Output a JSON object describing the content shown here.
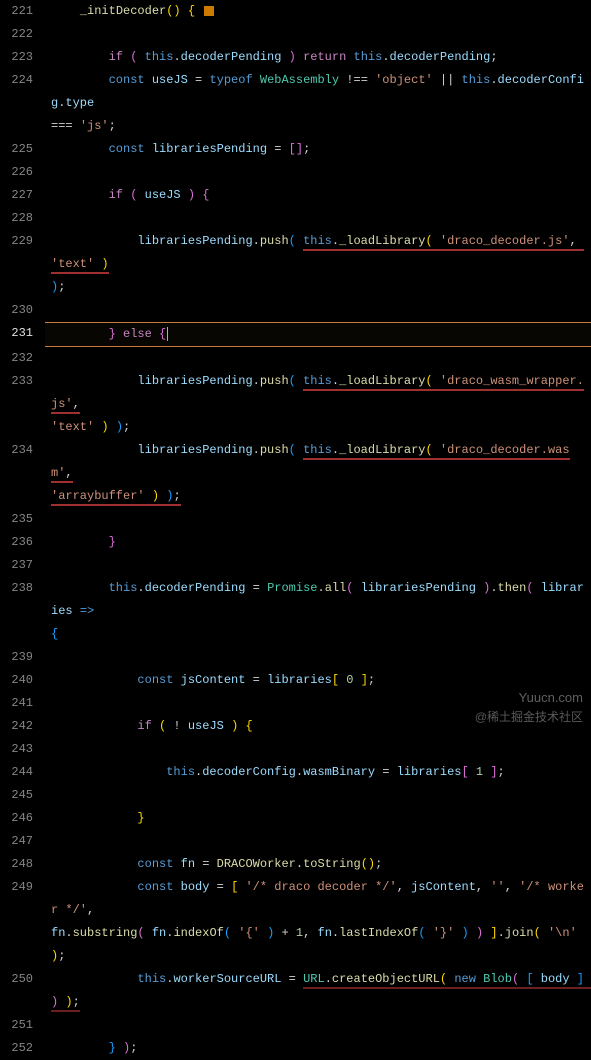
{
  "lineNumbers": [
    "221",
    "222",
    "223",
    "224",
    "",
    "225",
    "226",
    "227",
    "228",
    "229",
    "",
    "230",
    "231",
    "232",
    "233",
    "",
    "234",
    "",
    "235",
    "236",
    "237",
    "238",
    "",
    "239",
    "240",
    "241",
    "242",
    "243",
    "244",
    "245",
    "246",
    "247",
    "248",
    "249",
    "",
    "250",
    "251",
    "252"
  ],
  "code": {
    "l221_fn": "_initDecoder",
    "kw_if": "if",
    "kw_return": "return",
    "kw_this": "this",
    "kw_const": "const",
    "kw_typeof": "typeof",
    "kw_else": "else",
    "kw_new": "new",
    "prop_decoderPending": "decoderPending",
    "var_useJS": "useJS",
    "cls_WebAssembly": "WebAssembly",
    "str_object": "'object'",
    "prop_decoderConfig": "decoderConfig",
    "prop_type": "type",
    "str_js": "'js'",
    "var_librariesPending": "librariesPending",
    "fn_push": "push",
    "fn_loadLibrary": "_loadLibrary",
    "str_draco_decoder_js": "'draco_decoder.js'",
    "str_text": "'text'",
    "str_draco_wasm_wrapper": "'draco_wasm_wrapper.js'",
    "str_draco_decoder_wasm": "'draco_decoder.wasm'",
    "str_arraybuffer": "'arraybuffer'",
    "cls_Promise": "Promise",
    "fn_all": "all",
    "fn_then": "then",
    "var_libraries": "libraries",
    "var_jsContent": "jsContent",
    "num_0": "0",
    "num_1": "1",
    "prop_wasmBinary": "wasmBinary",
    "var_fn": "fn",
    "cls_DRACOWorker": "DRACOWorker",
    "fn_toString": "toString",
    "var_body": "body",
    "str_draco_comment": "'/* draco decoder */'",
    "str_empty": "''",
    "str_worker_comment": "'/* worker */'",
    "fn_substring": "substring",
    "fn_indexOf": "indexOf",
    "fn_lastIndexOf": "lastIndexOf",
    "str_open_brace": "'{'",
    "str_close_brace": "'}'",
    "fn_join": "join",
    "str_newline": "'\\n'",
    "prop_workerSourceURL": "workerSourceURL",
    "cls_URL": "URL",
    "fn_createObjectURL": "createObjectURL",
    "cls_Blob": "Blob"
  },
  "watermarks": {
    "w1": "Yuucn.com",
    "w2": "@稀土掘金技术社区"
  }
}
